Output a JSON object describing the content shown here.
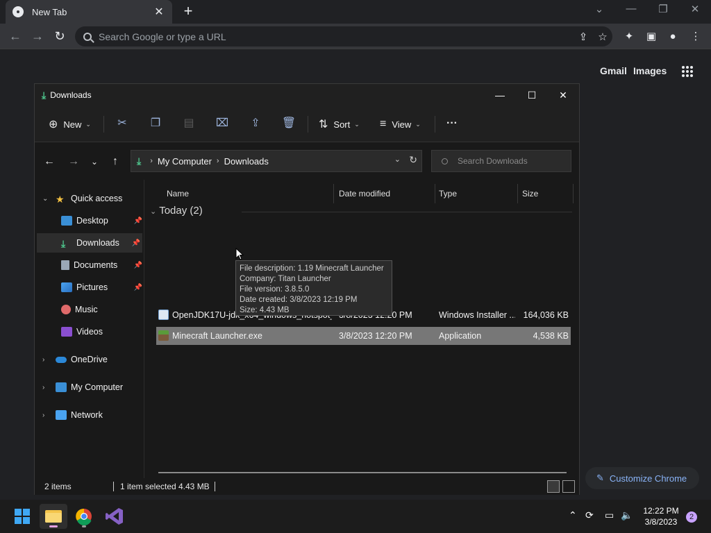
{
  "browser": {
    "tab_title": "New Tab",
    "omnibox_placeholder": "Search Google or type a URL",
    "ntp_links": {
      "gmail": "Gmail",
      "images": "Images"
    },
    "customize_label": "Customize Chrome"
  },
  "explorer": {
    "title": "Downloads",
    "commands": {
      "new": "New",
      "sort": "Sort",
      "view": "View"
    },
    "breadcrumb": [
      "My Computer",
      "Downloads"
    ],
    "search_placeholder": "Search Downloads",
    "nav": {
      "quick_access": "Quick access",
      "desktop": "Desktop",
      "downloads": "Downloads",
      "documents": "Documents",
      "pictures": "Pictures",
      "music": "Music",
      "videos": "Videos",
      "onedrive": "OneDrive",
      "my_computer": "My Computer",
      "network": "Network"
    },
    "columns": {
      "name": "Name",
      "date": "Date modified",
      "type": "Type",
      "size": "Size"
    },
    "group_label": "Today (2)",
    "files": [
      {
        "name": "OpenJDK17U-jdk_x64_windows_hotspot_...",
        "date": "3/8/2023 12:20 PM",
        "type": "Windows Installer ...",
        "size": "164,036 KB"
      },
      {
        "name": "Minecraft Launcher.exe",
        "date": "3/8/2023 12:20 PM",
        "type": "Application",
        "size": "4,538 KB"
      }
    ],
    "tooltip": {
      "description": "File description: 1.19 Minecraft Launcher",
      "company": "Company: Titan Launcher",
      "version": "File version: 3.8.5.0",
      "created": "Date created: 3/8/2023 12:19 PM",
      "size": "Size: 4.43 MB"
    },
    "status": {
      "items": "2 items",
      "selected": "1 item selected",
      "sel_size": "4.43 MB"
    }
  },
  "taskbar": {
    "time": "12:22 PM",
    "date": "3/8/2023",
    "notification_count": "2"
  }
}
